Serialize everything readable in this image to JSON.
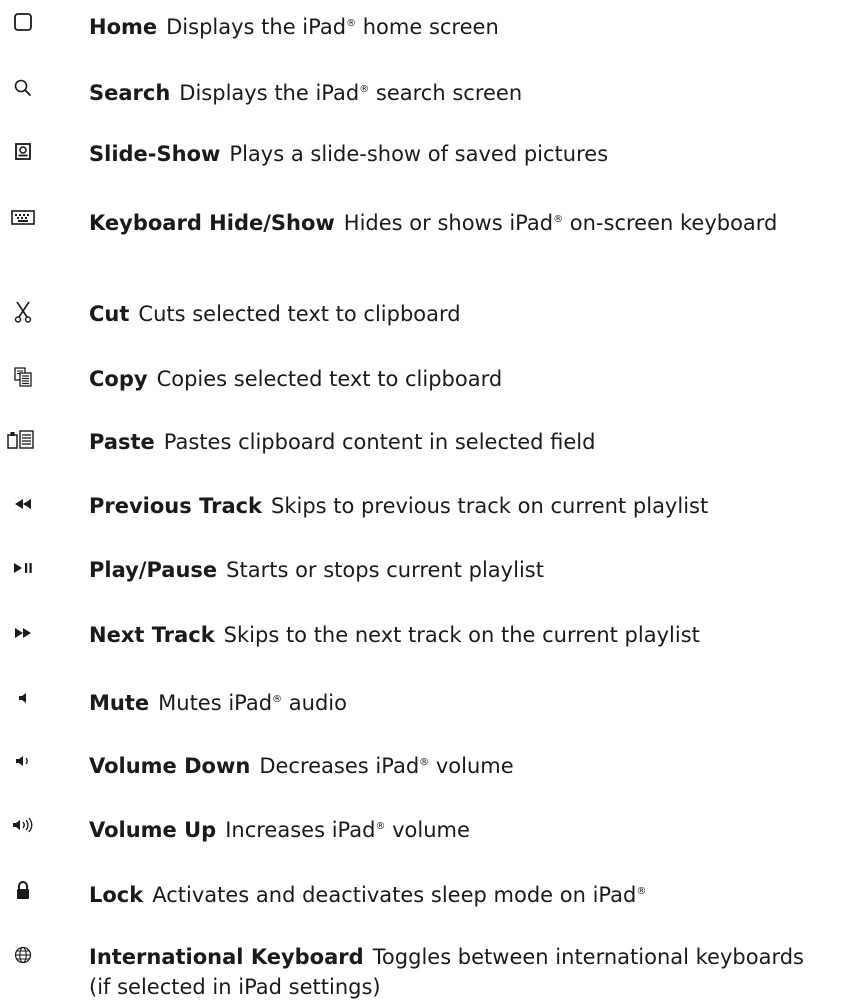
{
  "items": [
    {
      "icon": "home-square-icon",
      "name": "Home",
      "desc_before": "Displays the iPad",
      "desc_after": " home screen",
      "reg": "®"
    },
    {
      "icon": "search-icon",
      "name": "Search",
      "desc_before": "Displays the iPad",
      "desc_after": " search screen",
      "reg": "®"
    },
    {
      "icon": "slideshow-icon",
      "name": "Slide-Show",
      "desc_before": "Plays a slide-show of saved pictures",
      "desc_after": "",
      "reg": ""
    },
    {
      "icon": "keyboard-icon",
      "name": "Keyboard Hide/Show",
      "desc_before": "Hides or shows iPad",
      "desc_after": " on-screen keyboard",
      "reg": "®"
    },
    {
      "icon": "scissors-icon",
      "name": "Cut",
      "desc_before": "Cuts selected text to clipboard",
      "desc_after": "",
      "reg": ""
    },
    {
      "icon": "copy-icon",
      "name": "Copy",
      "desc_before": "Copies selected text to clipboard",
      "desc_after": "",
      "reg": ""
    },
    {
      "icon": "paste-icon",
      "name": "Paste",
      "desc_before": "Pastes clipboard content in selected field",
      "desc_after": "",
      "reg": ""
    },
    {
      "icon": "previous-track-icon",
      "name": "Previous Track",
      "desc_before": "Skips to previous track on current playlist",
      "desc_after": "",
      "reg": ""
    },
    {
      "icon": "play-pause-icon",
      "name": "Play/Pause",
      "desc_before": "Starts or stops current playlist",
      "desc_after": "",
      "reg": ""
    },
    {
      "icon": "next-track-icon",
      "name": "Next Track",
      "desc_before": "Skips to the next track on the current playlist",
      "desc_after": "",
      "reg": ""
    },
    {
      "icon": "mute-icon",
      "name": "Mute",
      "desc_before": "Mutes iPad",
      "desc_after": " audio",
      "reg": "®"
    },
    {
      "icon": "volume-down-icon",
      "name": "Volume Down",
      "desc_before": "Decreases iPad",
      "desc_after": " volume",
      "reg": "®"
    },
    {
      "icon": "volume-up-icon",
      "name": "Volume Up",
      "desc_before": "Increases iPad",
      "desc_after": " volume",
      "reg": "®"
    },
    {
      "icon": "lock-icon",
      "name": "Lock",
      "desc_before": "Activates and deactivates sleep mode on iPad",
      "desc_after": "",
      "reg": "®"
    },
    {
      "icon": "globe-icon",
      "name": "International Keyboard",
      "desc_before": "Toggles between international keyboards (if selected in iPad settings)",
      "desc_after": "",
      "reg": ""
    }
  ]
}
